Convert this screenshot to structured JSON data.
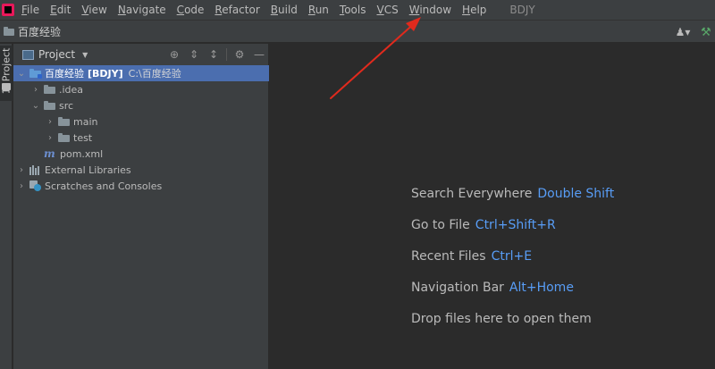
{
  "menubar": {
    "items": [
      "File",
      "Edit",
      "View",
      "Navigate",
      "Code",
      "Refactor",
      "Build",
      "Run",
      "Tools",
      "VCS",
      "Window",
      "Help"
    ],
    "project_name": "BDJY"
  },
  "navbar": {
    "breadcrumb": "百度经验"
  },
  "toolstrip": {
    "tab_label": "1: Project"
  },
  "project_panel": {
    "title": "Project",
    "tree": [
      {
        "label": "百度经验",
        "module": "[BDJY]",
        "path": "C:\\百度经验"
      },
      {
        "label": ".idea"
      },
      {
        "label": "src"
      },
      {
        "label": "main"
      },
      {
        "label": "test"
      },
      {
        "label": "pom.xml"
      },
      {
        "label": "External Libraries"
      },
      {
        "label": "Scratches and Consoles"
      }
    ]
  },
  "editor": {
    "hints": [
      {
        "text": "Search Everywhere",
        "shortcut": "Double Shift"
      },
      {
        "text": "Go to File",
        "shortcut": "Ctrl+Shift+R"
      },
      {
        "text": "Recent Files",
        "shortcut": "Ctrl+E"
      },
      {
        "text": "Navigation Bar",
        "shortcut": "Alt+Home"
      },
      {
        "text": "Drop files here to open them",
        "shortcut": ""
      }
    ]
  },
  "colors": {
    "selection": "#4b6eaf",
    "shortcut_blue": "#589df6",
    "annotation_red": "#e02a1d",
    "panel_bg": "#3c3f41",
    "editor_bg": "#2b2b2b"
  }
}
